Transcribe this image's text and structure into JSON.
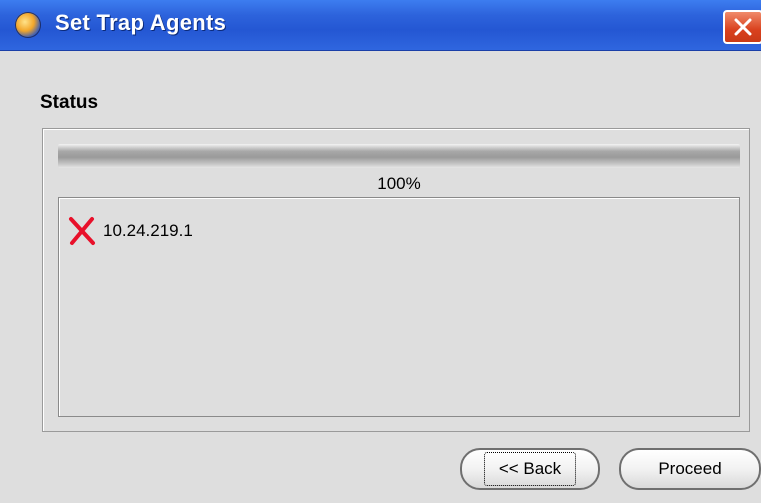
{
  "window": {
    "title": "Set Trap Agents",
    "app_icon": "globe-icon",
    "close_icon": "close-icon",
    "accent_color": "#2457d3",
    "close_color": "#d9411e"
  },
  "status": {
    "label": "Status",
    "progress_percent": 100,
    "progress_text": "100%"
  },
  "results": {
    "items": [
      {
        "icon": "error-x-icon",
        "host": "10.24.219.1"
      }
    ]
  },
  "buttons": {
    "back_label": "<< Back",
    "proceed_label": "Proceed"
  }
}
